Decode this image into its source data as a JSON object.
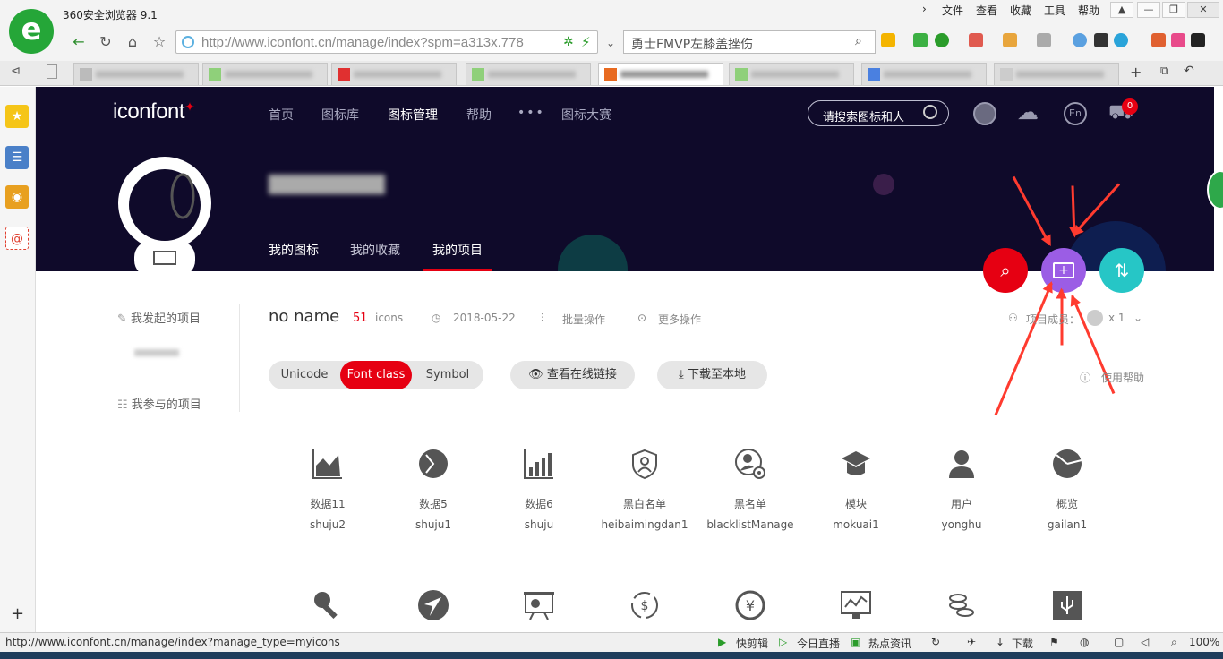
{
  "browser": {
    "title": "360安全浏览器 9.1",
    "menu": [
      "文件",
      "查看",
      "收藏",
      "工具",
      "帮助"
    ],
    "url": "http://www.iconfont.cn/manage/index?spm=a313x.778",
    "search_text": "勇士FMVP左膝盖挫伤"
  },
  "site": {
    "logo": "iconfont",
    "nav": [
      "首页",
      "图标库",
      "图标管理",
      "帮助",
      "•••",
      "图标大赛"
    ],
    "search_placeholder": "请搜索图标和人",
    "lang": "En",
    "cart_count": "0",
    "sub_tabs": [
      "我的图标",
      "我的收藏",
      "我的项目"
    ]
  },
  "sidebar": {
    "started_projects": "我发起的项目",
    "joined_projects": "我参与的项目"
  },
  "project": {
    "name": "no name",
    "icon_count": "51",
    "icons_label": "icons",
    "date": "2018-05-22",
    "batch": "批量操作",
    "more": "更多操作",
    "members": "项目成员：",
    "member_count": "x 1",
    "help": "使用帮助",
    "segments": [
      "Unicode",
      "Font class",
      "Symbol"
    ],
    "view_link": "查看在线链接",
    "download": "下载至本地"
  },
  "icons": [
    {
      "name": "数据11",
      "code": "shuju2",
      "icon": "area-chart-icon"
    },
    {
      "name": "数据5",
      "code": "shuju1",
      "icon": "pie-chart-icon"
    },
    {
      "name": "数据6",
      "code": "shuju",
      "icon": "bar-chart-icon"
    },
    {
      "name": "黑白名单",
      "code": "heibaimingdan1",
      "icon": "shield-user-icon"
    },
    {
      "name": "黑名单",
      "code": "blacklistManage",
      "icon": "user-gear-icon"
    },
    {
      "name": "模块",
      "code": "mokuai1",
      "icon": "graduation-cap-icon"
    },
    {
      "name": "用户",
      "code": "yonghu",
      "icon": "user-icon"
    },
    {
      "name": "概览",
      "code": "gailan1",
      "icon": "pie-slice-icon"
    }
  ],
  "icons_row2": [
    "key-icon",
    "navigation-arrow-icon",
    "presentation-icon",
    "currency-exchange-icon",
    "yen-icon",
    "monitor-chart-icon",
    "coins-icon",
    "usb-icon"
  ],
  "status": {
    "url": "http://www.iconfont.cn/manage/index?manage_type=myicons",
    "items": [
      "快剪辑",
      "今日直播",
      "热点资讯",
      "下载"
    ],
    "zoom": "100%"
  },
  "colors": {
    "header_bg": "#0f0a2a",
    "brand_red": "#e60012",
    "fab_search": "#e60012",
    "fab_add": "#9b5de5",
    "fab_sort": "#26c6c6"
  }
}
